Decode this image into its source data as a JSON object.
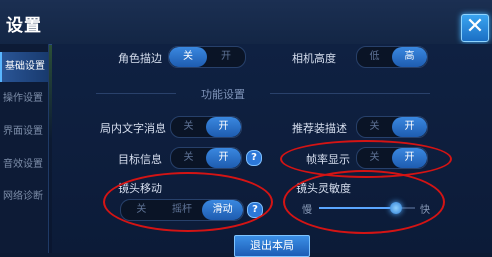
{
  "header": {
    "title": "设置",
    "close_icon": "close-x-icon"
  },
  "sidebar": {
    "items": [
      {
        "label": "基础设置",
        "active": true
      },
      {
        "label": "操作设置",
        "active": false
      },
      {
        "label": "界面设置",
        "active": false
      },
      {
        "label": "音效设置",
        "active": false
      },
      {
        "label": "网络诊断",
        "active": false
      }
    ]
  },
  "settings": {
    "character_outline": {
      "label": "角色描边",
      "options": [
        "关",
        "开"
      ],
      "selected": "关"
    },
    "camera_height": {
      "label": "相机高度",
      "options": [
        "低",
        "高"
      ],
      "selected": "高"
    },
    "section_title": "功能设置",
    "in_game_text": {
      "label": "局内文字消息",
      "options": [
        "关",
        "开"
      ],
      "selected": "开"
    },
    "recommended_desc": {
      "label": "推荐装描述",
      "options": [
        "关",
        "开"
      ],
      "selected": "开"
    },
    "target_info": {
      "label": "目标信息",
      "options": [
        "关",
        "开"
      ],
      "selected": "开",
      "help": "?"
    },
    "frame_rate": {
      "label": "帧率显示",
      "options": [
        "关",
        "开"
      ],
      "selected": "开"
    },
    "camera_move": {
      "label": "镜头移动",
      "options": [
        "关",
        "摇杆",
        "滑动"
      ],
      "selected": "滑动",
      "help": "?"
    },
    "camera_sensitivity": {
      "label": "镜头灵敏度",
      "min_label": "慢",
      "max_label": "快",
      "value": 0.8
    }
  },
  "footer": {
    "exit_label": "退出本局"
  },
  "colors": {
    "accent": "#2f7fd6",
    "annotation": "#d41414"
  }
}
